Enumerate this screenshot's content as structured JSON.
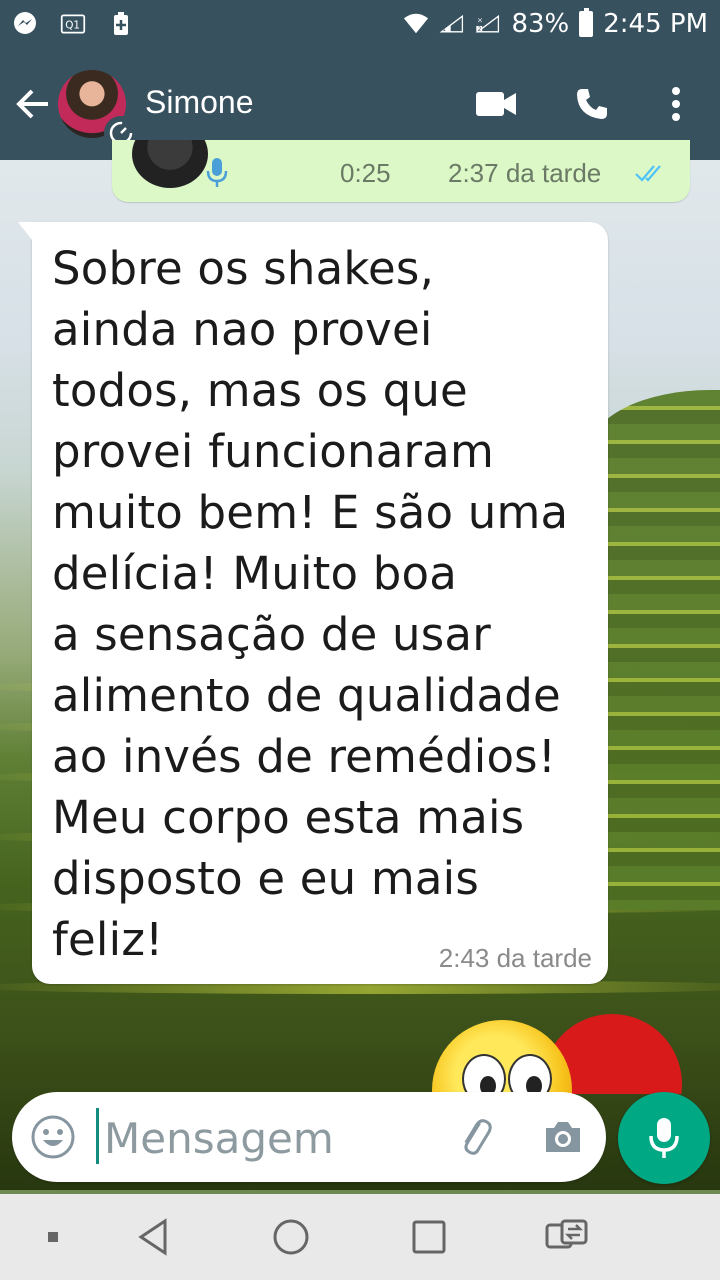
{
  "status_bar": {
    "battery_percent": "83%",
    "time": "2:45 PM",
    "icons": [
      "messenger-icon",
      "wifi-calling-icon",
      "battery-saver-icon",
      "wifi-icon",
      "signal-sim1-icon",
      "signal-sim2-icon",
      "battery-icon"
    ]
  },
  "header": {
    "contact_name": "Simone",
    "icons": [
      "back-arrow-icon",
      "video-call-icon",
      "phone-icon",
      "more-vert-icon"
    ]
  },
  "previous_message": {
    "duration": "0:25",
    "time": "2:37 da tarde",
    "status": "read"
  },
  "message": {
    "text": "Sobre os shakes,\nainda nao provei\ntodos, mas os que\nprovei funcionaram\nmuito bem! E são uma\ndelícia! Muito boa\na sensação de usar\nalimento de qualidade\nao invés de remédios!\nMeu corpo esta mais\ndisposto e eu mais\nfeliz!",
    "time": "2:43 da tarde"
  },
  "composer": {
    "placeholder": "Mensagem",
    "value": ""
  },
  "colors": {
    "header_bg": "#37515f",
    "outgoing_bubble": "#dcf8c6",
    "incoming_bubble": "#ffffff",
    "accent": "#00a884",
    "read_ticks": "#4fc3f7"
  },
  "nav_bar": {
    "icons": [
      "nav-menu-icon",
      "nav-back-icon",
      "nav-home-icon",
      "nav-recents-icon",
      "nav-switch-sim-icon"
    ]
  }
}
